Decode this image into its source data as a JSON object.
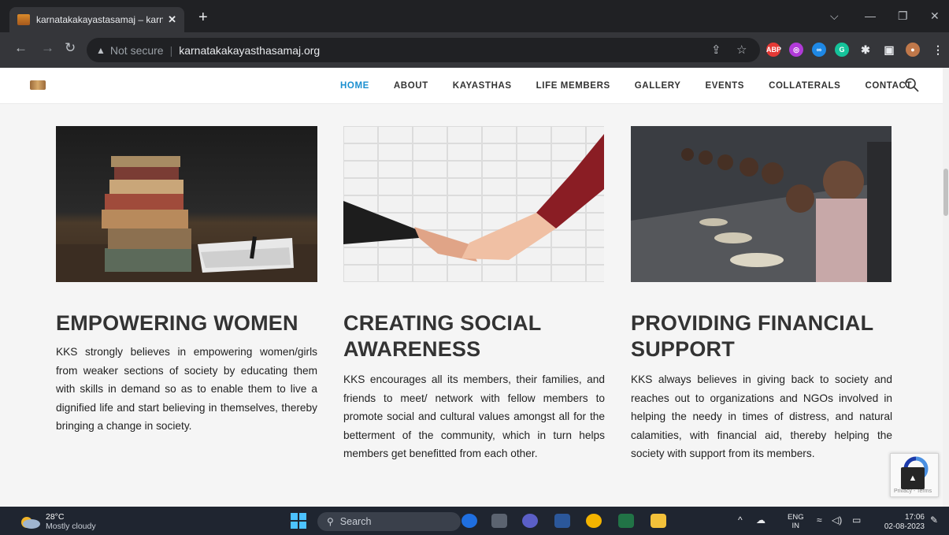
{
  "browser": {
    "tab_title": "karnatakakayastasamaj – karnatak",
    "security_label": "Not secure",
    "url": "karnatakakayasthasamaj.org"
  },
  "site": {
    "nav": [
      "HOME",
      "ABOUT",
      "KAYASTHAS",
      "LIFE MEMBERS",
      "GALLERY",
      "EVENTS",
      "COLLATERALS",
      "CONTACT"
    ],
    "active_nav": "HOME",
    "accent_color": "#1a8fd0",
    "cards": [
      {
        "title": "EMPOWERING WOMEN",
        "body": "KKS strongly believes in empowering women/girls from weaker sections of society by educating them with skills in demand so as to enable them to live a dignified life and start believing in themselves, thereby bringing a change in society.",
        "image": "stack-of-books-image"
      },
      {
        "title": "CREATING SOCIAL AWARENESS",
        "body": "KKS encourages all its members, their families, and friends to meet/ network with fellow members to promote social and cultural values amongst all for the betterment of the community, which in turn helps members get benefitted from each other.",
        "image": "handshake-image"
      },
      {
        "title": "PROVIDING FINANCIAL SUPPORT",
        "body": "KKS always believes in giving back to society and reaches out to organizations and NGOs involved in helping the needy in times of distress, and natural calamities, with financial aid, thereby helping the society with support from its members.",
        "image": "children-eating-image"
      }
    ],
    "recaptcha_text": "Privacy - Terms"
  },
  "taskbar": {
    "temperature": "28°C",
    "weather": "Mostly cloudy",
    "search_placeholder": "Search",
    "lang_line1": "ENG",
    "lang_line2": "IN",
    "time": "17:06",
    "date": "02-08-2023"
  }
}
